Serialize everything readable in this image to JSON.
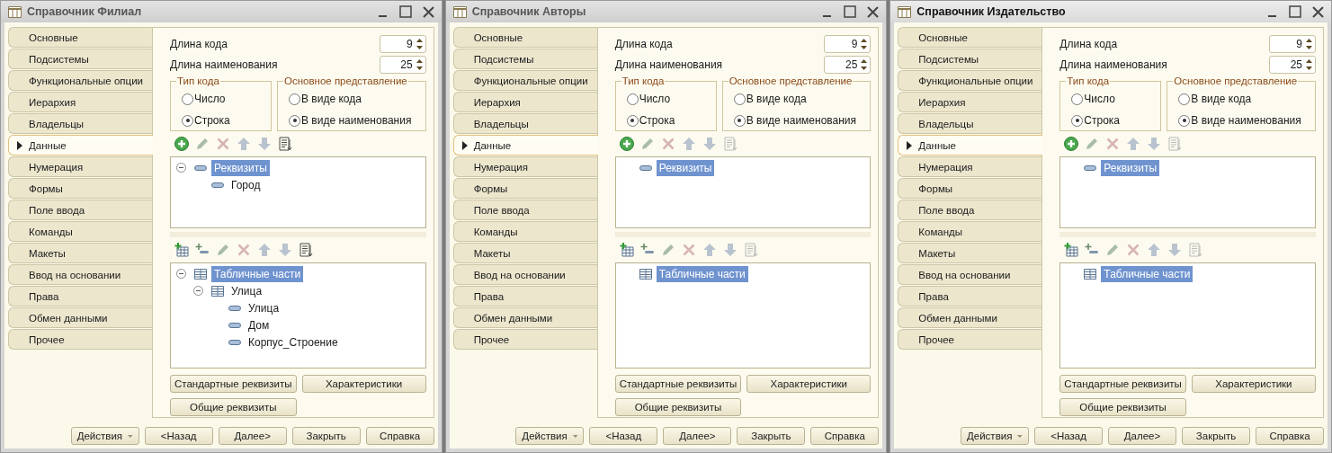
{
  "windows": [
    {
      "title": "Справочник Филиал",
      "active": false,
      "tabs": [
        {
          "label": "Основные",
          "selected": false
        },
        {
          "label": "Подсистемы",
          "selected": false
        },
        {
          "label": "Функциональные опции",
          "selected": false
        },
        {
          "label": "Иерархия",
          "selected": false
        },
        {
          "label": "Владельцы",
          "selected": false
        },
        {
          "label": "Данные",
          "selected": true
        },
        {
          "label": "Нумерация",
          "selected": false
        },
        {
          "label": "Формы",
          "selected": false
        },
        {
          "label": "Поле ввода",
          "selected": false
        },
        {
          "label": "Команды",
          "selected": false
        },
        {
          "label": "Макеты",
          "selected": false
        },
        {
          "label": "Ввод на основании",
          "selected": false
        },
        {
          "label": "Права",
          "selected": false
        },
        {
          "label": "Обмен данными",
          "selected": false
        },
        {
          "label": "Прочее",
          "selected": false
        }
      ],
      "fields": [
        {
          "label": "Длина кода",
          "value": "9"
        },
        {
          "label": "Длина наименования",
          "value": "25"
        }
      ],
      "groups": [
        {
          "title": "Тип кода",
          "options": [
            {
              "label": "Число",
              "selected": false
            },
            {
              "label": "Строка",
              "selected": true
            }
          ]
        },
        {
          "title": "Основное представление",
          "options": [
            {
              "label": "В виде кода",
              "selected": false
            },
            {
              "label": "В виде наименования",
              "selected": true
            }
          ]
        }
      ],
      "attributes": {
        "toolbar": [
          {
            "kind": "add",
            "disabled": false
          },
          {
            "kind": "edit",
            "disabled": true
          },
          {
            "kind": "delete",
            "disabled": true
          },
          {
            "kind": "up",
            "disabled": true
          },
          {
            "kind": "down",
            "disabled": true
          },
          {
            "kind": "list",
            "disabled": false
          }
        ],
        "tree": [
          {
            "label": "Реквизиты",
            "kind": "attribute",
            "selected": true,
            "expanded": true,
            "children": [
              {
                "label": "Город",
                "kind": "attribute",
                "selected": false
              }
            ]
          }
        ]
      },
      "tabular_sections": {
        "toolbar": [
          {
            "kind": "add_table",
            "disabled": false
          },
          {
            "kind": "add_row",
            "disabled": false
          },
          {
            "kind": "edit",
            "disabled": true
          },
          {
            "kind": "delete",
            "disabled": true
          },
          {
            "kind": "up",
            "disabled": true
          },
          {
            "kind": "down",
            "disabled": true
          },
          {
            "kind": "list",
            "disabled": false
          }
        ],
        "tree": [
          {
            "label": "Табличные части",
            "kind": "table",
            "selected": true,
            "expanded": true,
            "children": [
              {
                "label": "Улица",
                "kind": "table",
                "selected": false,
                "expanded": true,
                "children": [
                  {
                    "label": "Улица",
                    "kind": "attribute",
                    "selected": false
                  },
                  {
                    "label": "Дом",
                    "kind": "attribute",
                    "selected": false
                  },
                  {
                    "label": "Корпус_Строение",
                    "kind": "attribute",
                    "selected": false
                  }
                ]
              }
            ]
          }
        ]
      },
      "side_buttons": [
        "Стандартные реквизиты",
        "Характеристики",
        "Общие реквизиты"
      ],
      "buttons": [
        {
          "label": "Действия",
          "kind": "menu"
        },
        {
          "label": "<Назад",
          "kind": "plain"
        },
        {
          "label": "Далее>",
          "kind": "plain"
        },
        {
          "label": "Закрыть",
          "kind": "plain"
        },
        {
          "label": "Справка",
          "kind": "plain"
        }
      ]
    },
    {
      "title": "Справочник Авторы",
      "active": false,
      "tabs": [
        {
          "label": "Основные",
          "selected": false
        },
        {
          "label": "Подсистемы",
          "selected": false
        },
        {
          "label": "Функциональные опции",
          "selected": false
        },
        {
          "label": "Иерархия",
          "selected": false
        },
        {
          "label": "Владельцы",
          "selected": false
        },
        {
          "label": "Данные",
          "selected": true
        },
        {
          "label": "Нумерация",
          "selected": false
        },
        {
          "label": "Формы",
          "selected": false
        },
        {
          "label": "Поле ввода",
          "selected": false
        },
        {
          "label": "Команды",
          "selected": false
        },
        {
          "label": "Макеты",
          "selected": false
        },
        {
          "label": "Ввод на основании",
          "selected": false
        },
        {
          "label": "Права",
          "selected": false
        },
        {
          "label": "Обмен данными",
          "selected": false
        },
        {
          "label": "Прочее",
          "selected": false
        }
      ],
      "fields": [
        {
          "label": "Длина кода",
          "value": "9"
        },
        {
          "label": "Длина наименования",
          "value": "25"
        }
      ],
      "groups": [
        {
          "title": "Тип кода",
          "options": [
            {
              "label": "Число",
              "selected": false
            },
            {
              "label": "Строка",
              "selected": true
            }
          ]
        },
        {
          "title": "Основное представление",
          "options": [
            {
              "label": "В виде кода",
              "selected": false
            },
            {
              "label": "В виде наименования",
              "selected": true
            }
          ]
        }
      ],
      "attributes": {
        "toolbar": [
          {
            "kind": "add",
            "disabled": false
          },
          {
            "kind": "edit",
            "disabled": true
          },
          {
            "kind": "delete",
            "disabled": true
          },
          {
            "kind": "up",
            "disabled": true
          },
          {
            "kind": "down",
            "disabled": true
          },
          {
            "kind": "list",
            "disabled": true
          }
        ],
        "tree": [
          {
            "label": "Реквизиты",
            "kind": "attribute",
            "selected": true
          }
        ]
      },
      "tabular_sections": {
        "toolbar": [
          {
            "kind": "add_table",
            "disabled": false
          },
          {
            "kind": "add_row",
            "disabled": false
          },
          {
            "kind": "edit",
            "disabled": true
          },
          {
            "kind": "delete",
            "disabled": true
          },
          {
            "kind": "up",
            "disabled": true
          },
          {
            "kind": "down",
            "disabled": true
          },
          {
            "kind": "list",
            "disabled": true
          }
        ],
        "tree": [
          {
            "label": "Табличные части",
            "kind": "table",
            "selected": true
          }
        ]
      },
      "side_buttons": [
        "Стандартные реквизиты",
        "Характеристики",
        "Общие реквизиты"
      ],
      "buttons": [
        {
          "label": "Действия",
          "kind": "menu"
        },
        {
          "label": "<Назад",
          "kind": "plain"
        },
        {
          "label": "Далее>",
          "kind": "plain"
        },
        {
          "label": "Закрыть",
          "kind": "plain"
        },
        {
          "label": "Справка",
          "kind": "plain"
        }
      ]
    },
    {
      "title": "Справочник Издательство",
      "active": true,
      "tabs": [
        {
          "label": "Основные",
          "selected": false
        },
        {
          "label": "Подсистемы",
          "selected": false
        },
        {
          "label": "Функциональные опции",
          "selected": false
        },
        {
          "label": "Иерархия",
          "selected": false
        },
        {
          "label": "Владельцы",
          "selected": false
        },
        {
          "label": "Данные",
          "selected": true
        },
        {
          "label": "Нумерация",
          "selected": false
        },
        {
          "label": "Формы",
          "selected": false
        },
        {
          "label": "Поле ввода",
          "selected": false
        },
        {
          "label": "Команды",
          "selected": false
        },
        {
          "label": "Макеты",
          "selected": false
        },
        {
          "label": "Ввод на основании",
          "selected": false
        },
        {
          "label": "Права",
          "selected": false
        },
        {
          "label": "Обмен данными",
          "selected": false
        },
        {
          "label": "Прочее",
          "selected": false
        }
      ],
      "fields": [
        {
          "label": "Длина кода",
          "value": "9"
        },
        {
          "label": "Длина наименования",
          "value": "25"
        }
      ],
      "groups": [
        {
          "title": "Тип кода",
          "options": [
            {
              "label": "Число",
              "selected": false
            },
            {
              "label": "Строка",
              "selected": true
            }
          ]
        },
        {
          "title": "Основное представление",
          "options": [
            {
              "label": "В виде кода",
              "selected": false
            },
            {
              "label": "В виде наименования",
              "selected": true
            }
          ]
        }
      ],
      "attributes": {
        "toolbar": [
          {
            "kind": "add",
            "disabled": false
          },
          {
            "kind": "edit",
            "disabled": true
          },
          {
            "kind": "delete",
            "disabled": true
          },
          {
            "kind": "up",
            "disabled": true
          },
          {
            "kind": "down",
            "disabled": true
          },
          {
            "kind": "list",
            "disabled": true
          }
        ],
        "tree": [
          {
            "label": "Реквизиты",
            "kind": "attribute",
            "selected": true
          }
        ]
      },
      "tabular_sections": {
        "toolbar": [
          {
            "kind": "add_table",
            "disabled": false
          },
          {
            "kind": "add_row",
            "disabled": false
          },
          {
            "kind": "edit",
            "disabled": true
          },
          {
            "kind": "delete",
            "disabled": true
          },
          {
            "kind": "up",
            "disabled": true
          },
          {
            "kind": "down",
            "disabled": true
          },
          {
            "kind": "list",
            "disabled": true
          }
        ],
        "tree": [
          {
            "label": "Табличные части",
            "kind": "table",
            "selected": true
          }
        ]
      },
      "side_buttons": [
        "Стандартные реквизиты",
        "Характеристики",
        "Общие реквизиты"
      ],
      "buttons": [
        {
          "label": "Действия",
          "kind": "menu"
        },
        {
          "label": "<Назад",
          "kind": "plain"
        },
        {
          "label": "Далее>",
          "kind": "plain"
        },
        {
          "label": "Закрыть",
          "kind": "plain"
        },
        {
          "label": "Справка",
          "kind": "plain"
        }
      ]
    }
  ]
}
